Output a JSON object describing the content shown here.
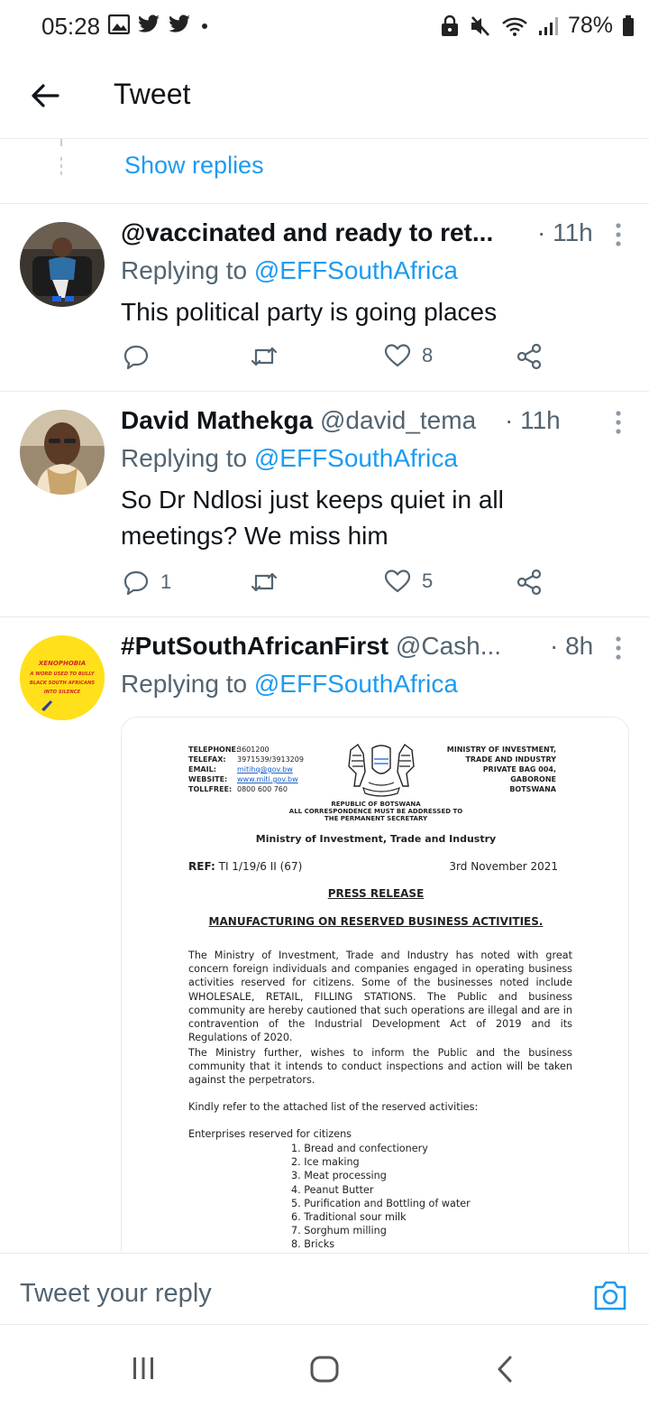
{
  "status_bar": {
    "time": "05:28",
    "battery": "78%"
  },
  "header": {
    "title": "Tweet"
  },
  "show_replies": "Show replies",
  "tweets": [
    {
      "name": "@vaccinated and ready to ret...",
      "handle": "",
      "time": "· 11h",
      "replying_prefix": "Replying to ",
      "replying_to": "@EFFSouthAfrica",
      "text": "This political party is going places",
      "replies": "",
      "likes": "8"
    },
    {
      "name": "David Mathekga",
      "handle": "@david_tema",
      "time": "· 11h",
      "replying_prefix": "Replying to ",
      "replying_to": "@EFFSouthAfrica",
      "text": "So Dr Ndlosi just keeps quiet in all meetings? We miss him",
      "replies": "1",
      "likes": "5"
    },
    {
      "name": "#PutSouthAfricanFirst",
      "handle": "@Cash...",
      "time": "· 8h",
      "replying_prefix": "Replying to ",
      "replying_to": "@EFFSouthAfrica",
      "avatar_text": [
        "XENOPHOBIA",
        "A WORD USED TO BULLY",
        "BLACK SOUTH AFRICANS",
        "INTO SILENCE"
      ]
    }
  ],
  "document": {
    "contacts": [
      {
        "k": "TELEPHONE:",
        "v": "3601200"
      },
      {
        "k": "TELEFAX:",
        "v": "3971539/3913209"
      },
      {
        "k": "EMAIL:",
        "v": "mitihq@gov.bw"
      },
      {
        "k": "WEBSITE:",
        "v": "www.miti.gov.bw"
      },
      {
        "k": "TOLLFREE:",
        "v": "0800 600 760"
      }
    ],
    "ministry_block": [
      "MINISTRY OF INVESTMENT,",
      "TRADE AND INDUSTRY",
      "PRIVATE BAG 004,",
      "GABORONE",
      "BOTSWANA"
    ],
    "republic": "REPUBLIC OF BOTSWANA",
    "correspondence_1": "ALL CORRESPONDENCE MUST BE ADDRESSED TO",
    "correspondence_2": "THE PERMANENT SECRETARY",
    "ministry_title": "Ministry of Investment, Trade and Industry",
    "ref_label": "REF:",
    "ref_value": "TI 1/19/6 II (67)",
    "date": "3rd November 2021",
    "press_release": "PRESS RELEASE",
    "heading": "MANUFACTURING ON RESERVED BUSINESS ACTIVITIES.",
    "para1": "The Ministry of Investment, Trade and Industry has noted with great concern foreign individuals and companies engaged in operating business activities reserved for citizens. Some of the businesses noted include WHOLESALE, RETAIL, FILLING STATIONS. The Public and business community are hereby cautioned that such operations are illegal and are in contravention of the Industrial Development Act of 2019 and its Regulations of 2020.",
    "para2": "The Ministry further, wishes to inform the Public and the business community that it intends to conduct inspections and action will be taken against the perpetrators.",
    "para3": "Kindly refer to the attached list of the reserved  activities:",
    "para4": "Enterprises reserved for citizens",
    "list": [
      "1. Bread and confectionery",
      "2. Ice making",
      "3. Meat processing",
      "4. Peanut Butter",
      "5. Purification and Bottling of water",
      "6. Traditional sour milk",
      "7. Sorghum milling",
      "8. Bricks"
    ]
  },
  "reply_bar": {
    "placeholder": "Tweet your reply"
  },
  "colors": {
    "accent": "#1d9bf0",
    "secondary_text": "#536471",
    "divider": "#e6ecf0",
    "avatar3_bg": "#ffe01b"
  }
}
